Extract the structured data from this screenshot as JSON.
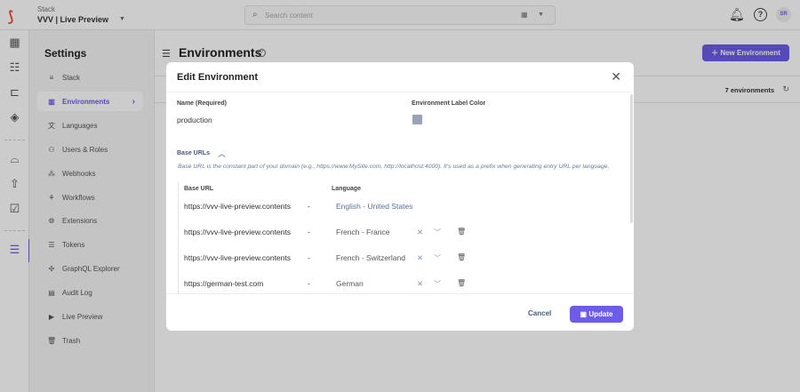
{
  "header": {
    "stack_label": "Stack",
    "stack_name": "VVV | Live Preview",
    "search_placeholder": "Search content",
    "avatar": "SR"
  },
  "settings": {
    "title": "Settings",
    "items": [
      {
        "label": "Stack",
        "icon": "≡"
      },
      {
        "label": "Environments",
        "icon": "▥"
      },
      {
        "label": "Languages",
        "icon": "文"
      },
      {
        "label": "Users & Roles",
        "icon": "⚇"
      },
      {
        "label": "Webhooks",
        "icon": "⁂"
      },
      {
        "label": "Workflows",
        "icon": "⚘"
      },
      {
        "label": "Extensions",
        "icon": "⚙"
      },
      {
        "label": "Tokens",
        "icon": "☰"
      },
      {
        "label": "GraphQL Explorer",
        "icon": "✣"
      },
      {
        "label": "Audit Log",
        "icon": "▤"
      },
      {
        "label": "Live Preview",
        "icon": "▶"
      },
      {
        "label": "Trash",
        "icon": "🗑"
      }
    ],
    "active": "Environments"
  },
  "main": {
    "title": "Environments",
    "new_button": "New Environment",
    "count": "7 environments"
  },
  "modal": {
    "title": "Edit Environment",
    "name_label": "Name (Required)",
    "name_value": "production",
    "color_label": "Environment Label Color",
    "label_color": "#9aa3b5",
    "base_urls_label": "Base URLs",
    "hint": "Base URL is the constant part of your domain (e.g., https://www.MySite.com, http://localhost:4000). It's used as a prefix when generating entry URL per language.",
    "col_base_url": "Base URL",
    "col_language": "Language",
    "rows": [
      {
        "url": "https://vvv-live-preview.contents",
        "sep": "-",
        "language": "English - United States"
      },
      {
        "url": "https://vvv-live-preview.contents",
        "sep": "-",
        "language": "French - France"
      },
      {
        "url": "https://vvv-live-preview.contents",
        "sep": "-",
        "language": "French - Switzerland"
      },
      {
        "url": "https://german-test.com",
        "sep": "-",
        "language": "German"
      }
    ],
    "cancel": "Cancel",
    "update": "Update"
  },
  "colors": {
    "accent": "#6c5ce7"
  }
}
